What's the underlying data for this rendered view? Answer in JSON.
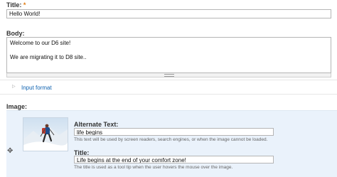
{
  "title_field": {
    "label": "Title:",
    "required_marker": "*",
    "value": "Hello World!"
  },
  "body_field": {
    "label": "Body:",
    "lines": [
      "Welcome to our D6 site!",
      "",
      "We are migrating it to D8 site.."
    ]
  },
  "input_format": {
    "toggle_symbol": "▷",
    "link_label": "Input format"
  },
  "image_field": {
    "label": "Image:",
    "drag_handle_symbol": "✥",
    "alt_text": {
      "label": "Alternate Text:",
      "value": "life begins",
      "description": "This text will be used by screen readers, search engines, or when the image cannot be loaded."
    },
    "title": {
      "label": "Title:",
      "value": "Life begins at the end of your comfort zone!",
      "description": "The title is used as a tool tip when the user hovers the mouse over the image."
    }
  },
  "colors": {
    "link": "#0e62b0",
    "required": "#e07a10",
    "panel_background": "#eaf2fb"
  }
}
